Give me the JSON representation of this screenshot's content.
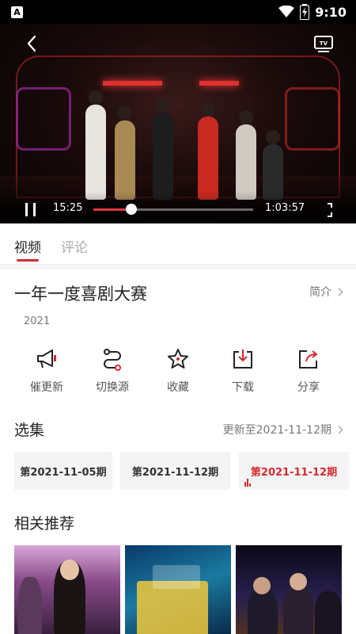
{
  "status_bar": {
    "time": "9:10",
    "app_badge": "A",
    "icons": [
      "wifi-icon",
      "battery-charging-icon"
    ]
  },
  "player": {
    "current_time": "15:25",
    "total_time": "1:03:57",
    "progress_fraction": 0.24,
    "icons": [
      "back-arrow-icon",
      "tv-cast-icon",
      "pause-icon",
      "fullscreen-icon"
    ]
  },
  "tabs": [
    {
      "label": "视频",
      "active": true
    },
    {
      "label": "评论",
      "active": false
    }
  ],
  "show": {
    "title": "一年一度喜剧大赛",
    "intro_label": "简介",
    "year": "2021"
  },
  "actions": [
    {
      "label": "催更新",
      "icon": "megaphone-icon"
    },
    {
      "label": "切换源",
      "icon": "switch-source-icon"
    },
    {
      "label": "收藏",
      "icon": "star-icon"
    },
    {
      "label": "下载",
      "icon": "download-icon"
    },
    {
      "label": "分享",
      "icon": "share-icon"
    }
  ],
  "episodes": {
    "title": "选集",
    "update_label": "更新至2021-11-12期",
    "items": [
      {
        "label": "第2021-11-05期",
        "active": false
      },
      {
        "label": "第2021-11-12期",
        "active": false
      },
      {
        "label": "第2021-11-12期",
        "active": true
      }
    ]
  },
  "related": {
    "title": "相关推荐"
  },
  "colors": {
    "accent": "#d42a2f",
    "text": "#222222",
    "muted": "#777777"
  }
}
